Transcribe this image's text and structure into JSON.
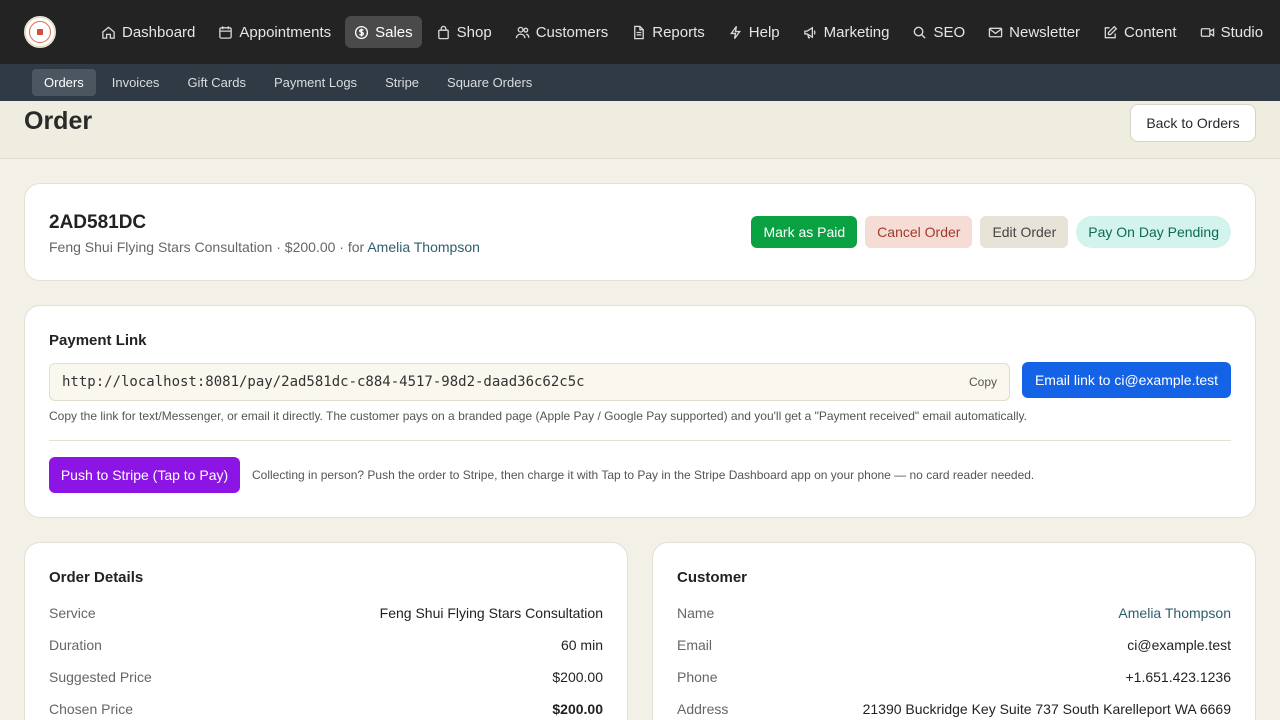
{
  "nav": {
    "items": [
      {
        "label": "Dashboard",
        "icon": "home-icon"
      },
      {
        "label": "Appointments",
        "icon": "calendar-icon"
      },
      {
        "label": "Sales",
        "icon": "dollar-icon",
        "active": true
      },
      {
        "label": "Shop",
        "icon": "bag-icon"
      },
      {
        "label": "Customers",
        "icon": "users-icon"
      },
      {
        "label": "Reports",
        "icon": "document-icon"
      },
      {
        "label": "Help",
        "icon": "bolt-icon"
      },
      {
        "label": "Marketing",
        "icon": "megaphone-icon"
      },
      {
        "label": "SEO",
        "icon": "search-icon"
      },
      {
        "label": "Newsletter",
        "icon": "mail-icon"
      },
      {
        "label": "Content",
        "icon": "edit-icon"
      },
      {
        "label": "Studio",
        "icon": "video-icon"
      }
    ]
  },
  "subnav": {
    "items": [
      {
        "label": "Orders",
        "active": true
      },
      {
        "label": "Invoices"
      },
      {
        "label": "Gift Cards"
      },
      {
        "label": "Payment Logs"
      },
      {
        "label": "Stripe"
      },
      {
        "label": "Square Orders"
      }
    ]
  },
  "header": {
    "title": "Order",
    "back_label": "Back to Orders"
  },
  "order": {
    "id": "2AD581DC",
    "service": "Feng Shui Flying Stars Consultation",
    "price": "$200.00",
    "for_text": "for",
    "customer": "Amelia Thompson",
    "actions": {
      "mark_paid": "Mark as Paid",
      "cancel": "Cancel Order",
      "edit": "Edit Order"
    },
    "status": "Pay On Day Pending"
  },
  "payment_link": {
    "title": "Payment Link",
    "url": "http://localhost:8081/pay/2ad581dc-c884-4517-98d2-daad36c62c5c",
    "copy_label": "Copy",
    "email_label": "Email link to ci@example.test",
    "help": "Copy the link for text/Messenger, or email it directly. The customer pays on a branded page (Apple Pay / Google Pay supported) and you'll get a \"Payment received\" email automatically.",
    "stripe_label": "Push to Stripe (Tap to Pay)",
    "stripe_help": "Collecting in person? Push the order to Stripe, then charge it with Tap to Pay in the Stripe Dashboard app on your phone — no card reader needed."
  },
  "order_details": {
    "title": "Order Details",
    "rows": [
      {
        "label": "Service",
        "value": "Feng Shui Flying Stars Consultation"
      },
      {
        "label": "Duration",
        "value": "60 min"
      },
      {
        "label": "Suggested Price",
        "value": "$200.00"
      },
      {
        "label": "Chosen Price",
        "value": "$200.00"
      }
    ]
  },
  "customer": {
    "title": "Customer",
    "rows": [
      {
        "label": "Name",
        "value": "Amelia Thompson"
      },
      {
        "label": "Email",
        "value": "ci@example.test"
      },
      {
        "label": "Phone",
        "value": "+1.651.423.1236"
      },
      {
        "label": "Address",
        "value": "21390 Buckridge Key Suite 737 South Karelleport WA 6669"
      }
    ]
  }
}
